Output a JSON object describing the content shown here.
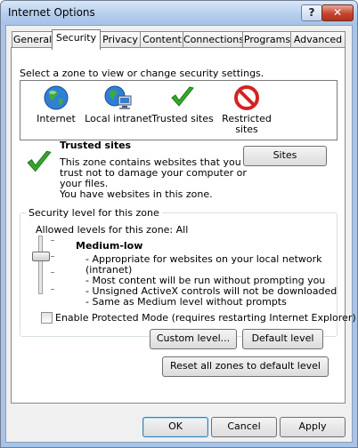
{
  "window": {
    "title": "Internet Options",
    "help_label": "?",
    "close_label": "✕"
  },
  "tabs": [
    "General",
    "Security",
    "Privacy",
    "Content",
    "Connections",
    "Programs",
    "Advanced"
  ],
  "active_tab": "Security",
  "zone_prompt": "Select a zone to view or change security settings.",
  "zones": [
    {
      "label": "Internet",
      "icon": "globe-icon"
    },
    {
      "label": "Local intranet",
      "icon": "intranet-icon"
    },
    {
      "label": "Trusted sites",
      "icon": "checkmark-icon"
    },
    {
      "label": "Restricted",
      "label2": "sites",
      "icon": "restricted-icon"
    }
  ],
  "selected_zone": "Trusted sites",
  "zone_info": {
    "heading": "Trusted sites",
    "lines": [
      "This zone contains websites that you",
      "trust not to damage your computer or",
      "your files.",
      "You have websites in this zone."
    ],
    "sites_button": "Sites"
  },
  "security_level": {
    "group_title": "Security level for this zone",
    "allowed": "Allowed levels for this zone: All",
    "level_name": "Medium-low",
    "level_fraction": 0.33,
    "bullets": [
      "- Appropriate for websites on your local network",
      "(intranet)",
      "- Most content will be run without prompting you",
      "- Unsigned ActiveX controls will not be downloaded",
      "- Same as Medium level without prompts"
    ],
    "protected_mode_label": "Enable Protected Mode (requires restarting Internet Explorer)",
    "protected_mode_checked": false,
    "custom_level_button": "Custom level...",
    "default_level_button": "Default level"
  },
  "reset_all_button": "Reset all zones to default level",
  "buttons": {
    "ok": "OK",
    "cancel": "Cancel",
    "apply": "Apply"
  },
  "colors": {
    "title_bar": "#b7cfee",
    "close_button": "#c5442d",
    "check_green": "#3aa52f",
    "restricted_red": "#d42222"
  }
}
